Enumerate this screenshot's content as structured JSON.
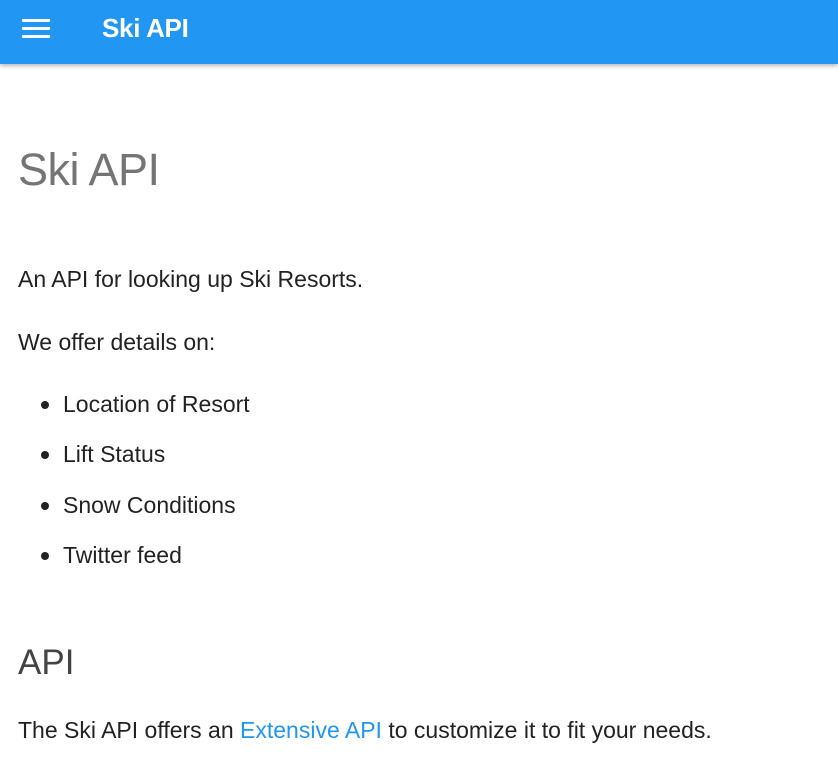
{
  "header": {
    "menu_icon": "hamburger-menu-icon",
    "title": "Ski API",
    "background_color": "#2196f3"
  },
  "main": {
    "title": "Ski API",
    "intro": "An API for looking up Ski Resorts.",
    "offer_text": "We offer details on:",
    "features": [
      "Location of Resort",
      "Lift Status",
      "Snow Conditions",
      "Twitter feed"
    ],
    "api_section": {
      "heading": "API",
      "text_before": "The Ski API offers an ",
      "link_text": "Extensive API",
      "text_after": " to customize it to fit your needs.",
      "link_color": "#2196f3"
    }
  }
}
